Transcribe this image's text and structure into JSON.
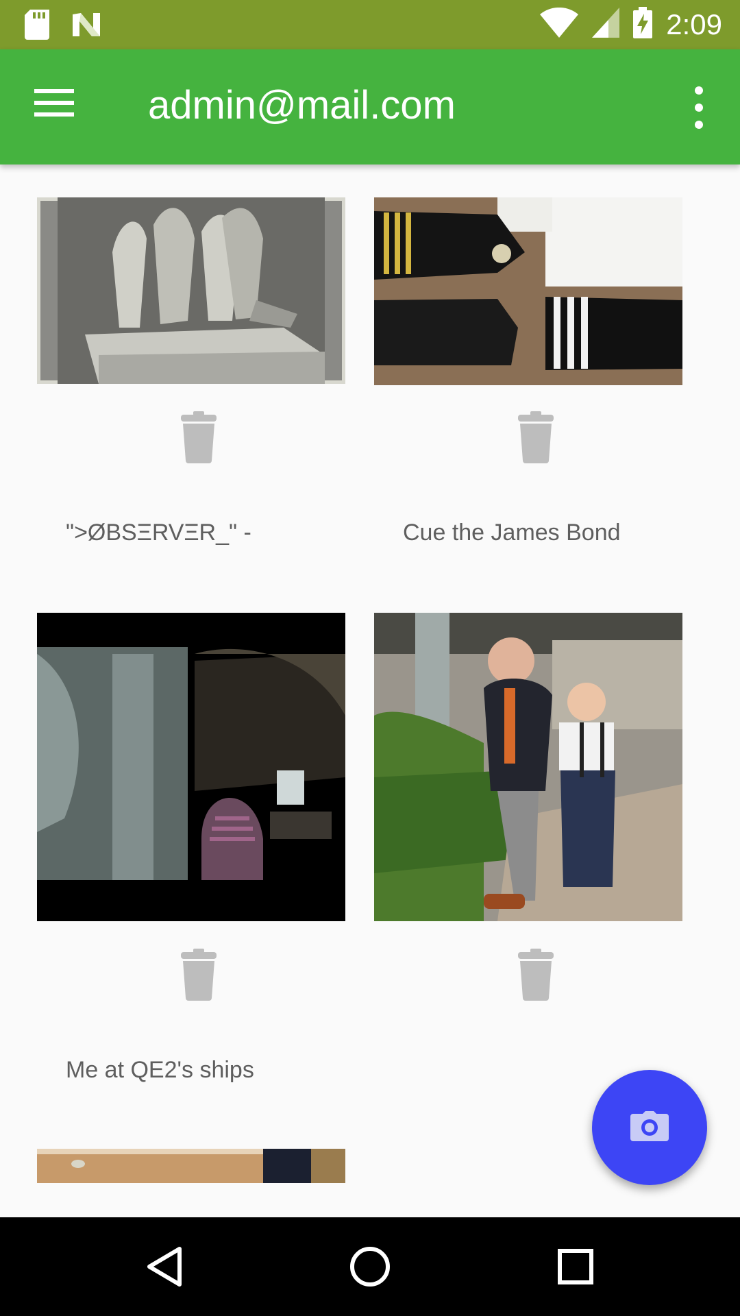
{
  "status_bar": {
    "time": "2:09",
    "icons": [
      "sd-card-icon",
      "n-notification-icon",
      "wifi-icon",
      "cell-signal-icon",
      "battery-charging-icon"
    ]
  },
  "app_bar": {
    "title": "admin@mail.com",
    "icons": [
      "hamburger-menu-icon",
      "overflow-menu-icon"
    ]
  },
  "grid": {
    "items": [
      {
        "caption": "\">ØBSΞRVΞR_\" -",
        "image": "sculpture-engraving",
        "action_icon": "trash-icon"
      },
      {
        "caption": "Cue the James Bond",
        "image": "shoulder-boards",
        "action_icon": "trash-icon"
      },
      {
        "caption": "Me at QE2's ships",
        "image": "dark-scene",
        "action_icon": "trash-icon"
      },
      {
        "caption": "",
        "image": "man-and-boy-thumbs-up",
        "action_icon": "trash-icon"
      },
      {
        "caption": "",
        "image": "interior-partial"
      }
    ]
  },
  "fab": {
    "icon": "camera-icon",
    "color": "#3d45f5"
  },
  "nav_bar": {
    "icons": [
      "back-icon",
      "home-icon",
      "recents-icon"
    ]
  },
  "colors": {
    "status_bar": "#7e9b2c",
    "app_bar": "#45b33f",
    "background": "#fafafa",
    "caption_text": "#5e5e5e",
    "trash_icon": "#bdbdbd"
  }
}
